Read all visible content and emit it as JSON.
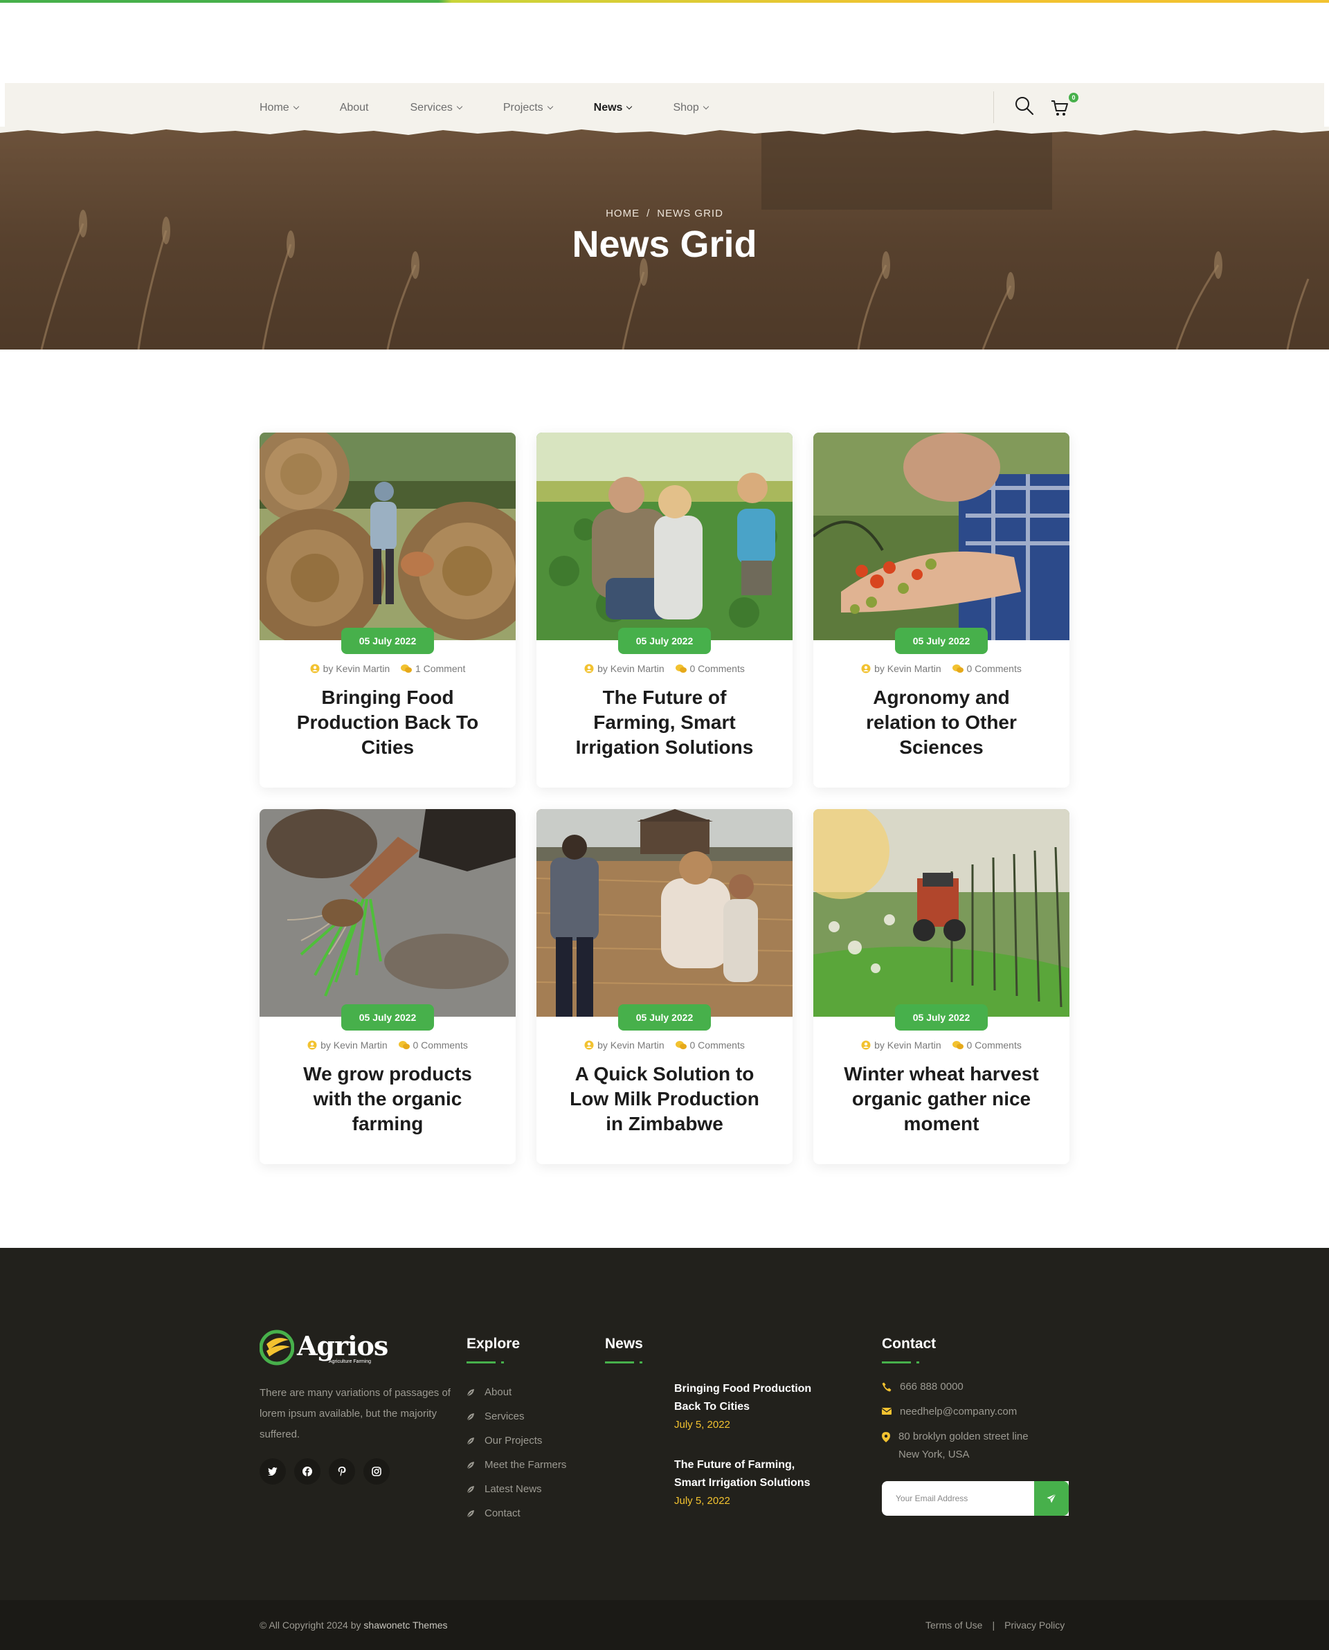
{
  "brand": {
    "accent": "#47b04b",
    "yellow": "#f2c230",
    "footer_bg": "#22211c"
  },
  "nav": {
    "items": [
      {
        "label": "Home",
        "dropdown": true
      },
      {
        "label": "About",
        "dropdown": false
      },
      {
        "label": "Services",
        "dropdown": true
      },
      {
        "label": "Projects",
        "dropdown": true
      },
      {
        "label": "News",
        "dropdown": true,
        "active": true
      },
      {
        "label": "Shop",
        "dropdown": true
      }
    ],
    "cart_count": "0"
  },
  "hero": {
    "breadcrumb_home": "HOME",
    "breadcrumb_sep": "/",
    "breadcrumb_current": "NEWS GRID",
    "title": "News Grid"
  },
  "posts": [
    {
      "date": "05 July 2022",
      "author": "by Kevin Martin",
      "comments": "1 Comment",
      "title": "Bringing Food Production Back To Cities"
    },
    {
      "date": "05 July 2022",
      "author": "by Kevin Martin",
      "comments": "0 Comments",
      "title": "The Future of Farming, Smart Irrigation Solutions"
    },
    {
      "date": "05 July 2022",
      "author": "by Kevin Martin",
      "comments": "0 Comments",
      "title": "Agronomy and relation to Other Sciences"
    },
    {
      "date": "05 July 2022",
      "author": "by Kevin Martin",
      "comments": "0 Comments",
      "title": "We grow products with the organic farming"
    },
    {
      "date": "05 July 2022",
      "author": "by Kevin Martin",
      "comments": "0 Comments",
      "title": "A Quick Solution to Low Milk Production in Zimbabwe"
    },
    {
      "date": "05 July 2022",
      "author": "by Kevin Martin",
      "comments": "0 Comments",
      "title": "Winter wheat harvest organic gather nice moment"
    }
  ],
  "footer": {
    "logo_text": "Agrios",
    "logo_sub": "Agriculture Farming",
    "about": "There are many variations of passages of lorem ipsum available, but the majority suffered.",
    "socials": [
      "twitter-icon",
      "facebook-icon",
      "pinterest-icon",
      "instagram-icon"
    ],
    "explore_heading": "Explore",
    "explore": [
      "About",
      "Services",
      "Our Projects",
      "Meet the Farmers",
      "Latest News",
      "Contact"
    ],
    "news_heading": "News",
    "news": [
      {
        "title": "Bringing Food Production Back To Cities",
        "date": "July 5, 2022"
      },
      {
        "title": "The Future of Farming, Smart Irrigation Solutions",
        "date": "July 5, 2022"
      }
    ],
    "contact_heading": "Contact",
    "phone": "666 888 0000",
    "email": "needhelp@company.com",
    "address_line1": "80 broklyn golden street line",
    "address_line2": "New York, USA",
    "email_placeholder": "Your Email Address",
    "copyright_prefix": "© All Copyright 2024 by",
    "copyright_who": "shawonetc Themes",
    "terms": "Terms of Use",
    "privacy": "Privacy Policy",
    "legal_sep": "|"
  }
}
